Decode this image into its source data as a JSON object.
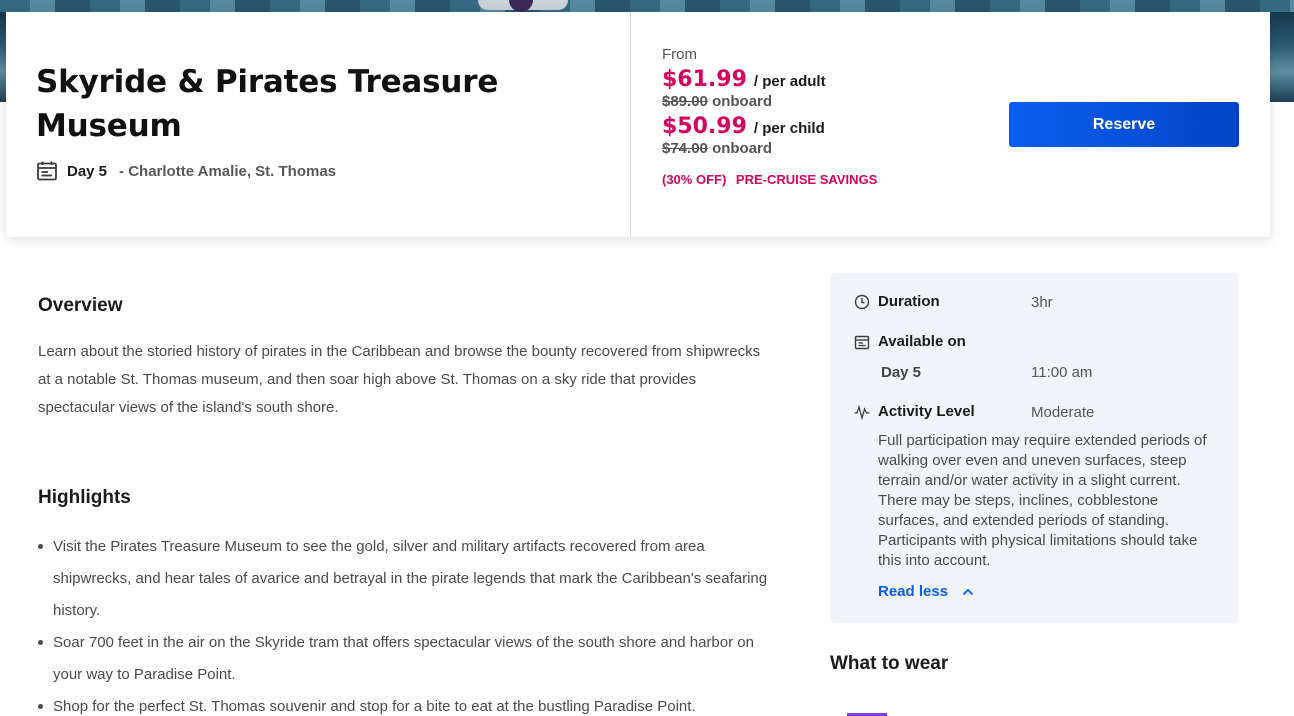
{
  "header": {
    "title": "Skyride & Pirates Treasure Museum",
    "day": "Day 5",
    "location": "- Charlotte Amalie, St. Thomas"
  },
  "pricing": {
    "from_label": "From",
    "adult_price": "$61.99",
    "adult_unit": "/ per adult",
    "adult_onboard_price": "$89.00",
    "onboard_label": "onboard",
    "child_price": "$50.99",
    "child_unit": "/ per child",
    "child_onboard_price": "$74.00",
    "discount": "(30% OFF)",
    "savings_label": "PRE-CRUISE SAVINGS",
    "reserve_label": "Reserve",
    "accent_color": "#d6045f",
    "button_color": "#0a5ff0"
  },
  "overview": {
    "heading": "Overview",
    "text": "Learn about the storied history of pirates in the Caribbean and browse the bounty recovered from shipwrecks at a notable St. Thomas museum, and then soar high above St. Thomas on a sky ride that provides spectacular views of the island's south shore."
  },
  "highlights": {
    "heading": "Highlights",
    "items": [
      "Visit the Pirates Treasure Museum to see the gold, silver and military artifacts recovered from area shipwrecks, and hear tales of avarice and betrayal in the pirate legends that mark the Caribbean's seafaring history.",
      "Soar 700 feet in the air on the Skyride tram that offers spectacular views of the south shore and harbor on your way to Paradise Point.",
      "Shop for the perfect St. Thomas souvenir and stop for a bite to eat at the bustling Paradise Point."
    ]
  },
  "details": {
    "duration_label": "Duration",
    "duration_value": "3hr",
    "available_label": "Available on",
    "available_day": "Day 5",
    "available_time": "11:00 am",
    "activity_label": "Activity Level",
    "activity_value": "Moderate",
    "activity_description": "Full participation may require extended periods of walking over even and uneven surfaces, steep terrain and/or water activity in a slight current. There may be steps, inclines, cobblestone surfaces, and extended periods of standing. Participants with physical limitations should take this into account.",
    "read_less_label": "Read less",
    "icons": [
      "calendar-icon",
      "clock-icon",
      "activity-pulse-icon",
      "chevron-up-icon"
    ]
  },
  "what_to_wear": {
    "heading": "What to wear"
  }
}
